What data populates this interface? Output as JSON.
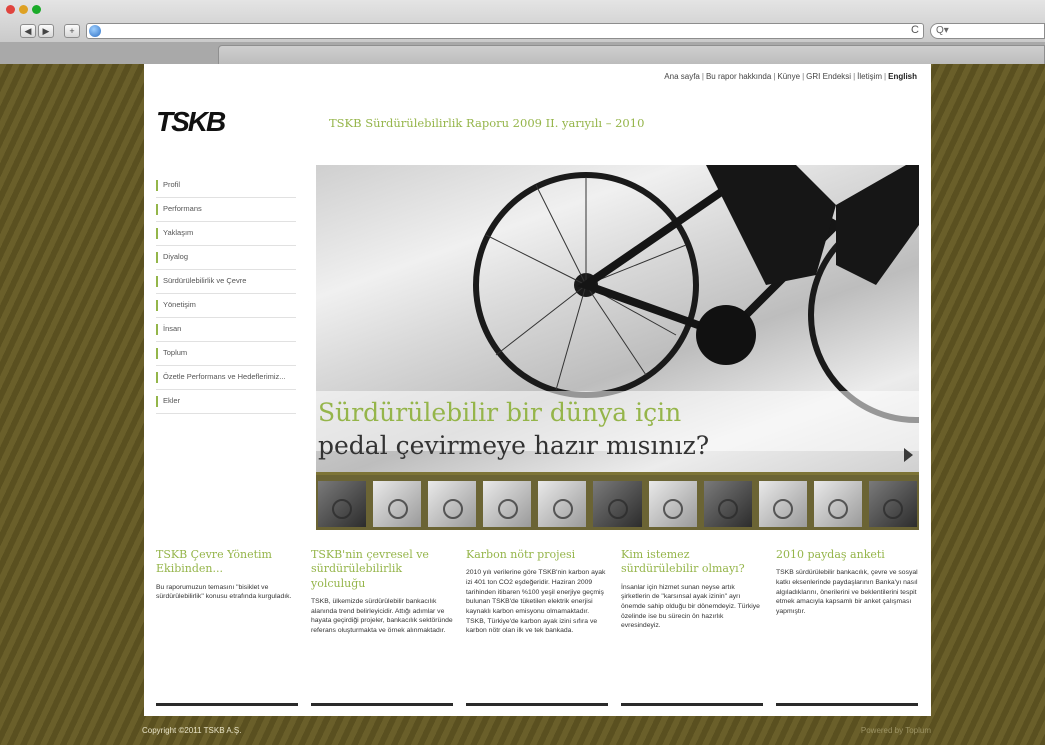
{
  "browser": {
    "reload_glyph": "C",
    "search_glyph": "Q▾"
  },
  "site": {
    "top_nav": [
      "Ana sayfa",
      "Bu rapor hakkında",
      "Künye",
      "GRI Endeksi",
      "İletişim",
      "English"
    ],
    "logo": "TSKB",
    "headline": "TSKB Sürdürülebilirlik Raporu 2009 II. yarıyılı – 2010",
    "sidebar": [
      "Profil",
      "Performans",
      "Yaklaşım",
      "Diyalog",
      "Sürdürülebilirlik ve Çevre",
      "Yönetişim",
      "İnsan",
      "Toplum",
      "Özetle Performans ve Hedeflerimiz...",
      "Ekler"
    ],
    "hero": {
      "line1": "Sürdürülebilir bir dünya için",
      "line2": "pedal çevirmeye hazır mısınız?"
    },
    "columns": [
      {
        "title": "TSKB Çevre Yönetim Ekibinden...",
        "body": "Bu raporumuzun temasını \"bisiklet ve sürdürülebilirlik\" konusu etrafında kurguladık."
      },
      {
        "title": "TSKB'nin çevresel ve sürdürülebilirlik yolculuğu",
        "body": "TSKB, ülkemizde sürdürülebilir bankacılık alanında trend belirleyicidir. Attığı adımlar ve hayata geçirdiği projeler, bankacılık sektöründe referans oluşturmakta ve örnek alınmaktadır."
      },
      {
        "title": "Karbon nötr projesi",
        "body": "2010 yılı verilerine göre TSKB'nin karbon ayak izi 401 ton CO2 eşdeğeridir. Haziran 2009 tarihinden itibaren %100 yeşil enerjiye geçmiş bulunan TSKB'de tüketilen elektrik enerjisi kaynaklı karbon emisyonu olmamaktadır. TSKB, Türkiye'de karbon ayak izini sıfıra ve karbon nötr olan ilk ve tek bankada."
      },
      {
        "title": "Kim istemez sürdürülebilir olmayı?",
        "body": "İnsanlar için hizmet sunan neyse artık şirketlerin de \"karsınsal ayak izinin\" ayrı önemde sahip olduğu bir dönemdeyiz. Türkiye özelinde ise bu sürecin ön hazırlık evresindeyiz."
      },
      {
        "title": "2010 paydaş anketi",
        "body": "TSKB sürdürülebilir bankacılık, çevre ve sosyal katkı eksenlerinde paydaşlarının Banka'yı nasıl algıladıklarını, önerilerini ve beklentilerini tespit etmek amacıyla kapsamlı bir anket çalışması yapmıştır."
      }
    ],
    "footer": {
      "copyright": "Copyright ©2011 TSKB A.Ş.",
      "powered": "Powered by Toplum"
    }
  },
  "colors": {
    "accent_green": "#95b54a",
    "background_olive": "#5e5422",
    "thumb_strip": "#6b6434"
  }
}
